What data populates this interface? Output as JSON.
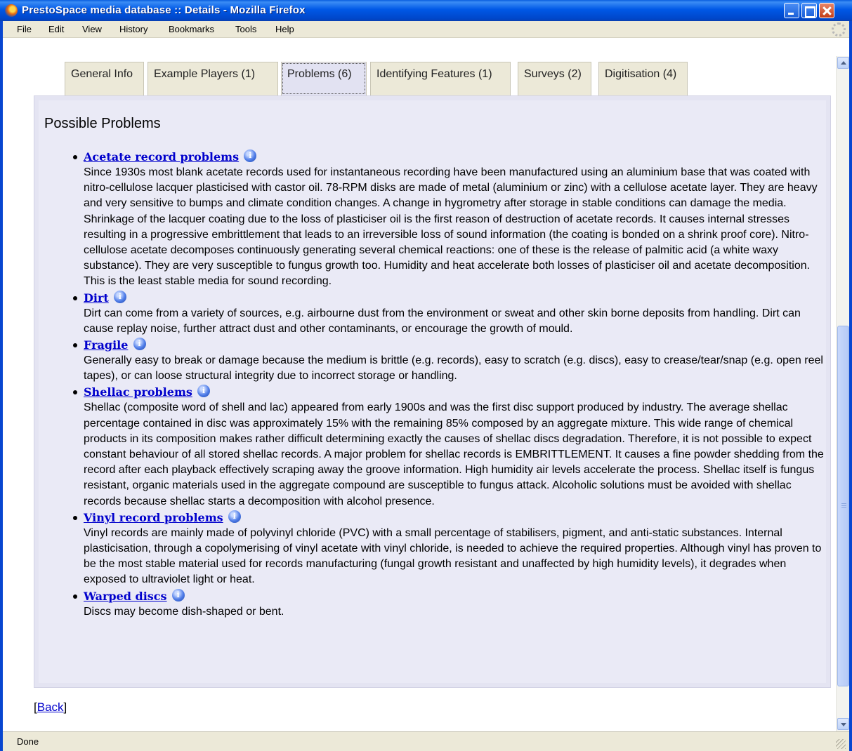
{
  "window": {
    "title": "PrestoSpace media database :: Details - Mozilla Firefox"
  },
  "menu": {
    "items": [
      "File",
      "Edit",
      "View",
      "History",
      "Bookmarks",
      "Tools",
      "Help"
    ]
  },
  "tabs": [
    {
      "label": "General Info",
      "active": false
    },
    {
      "label": "Example Players (1)",
      "active": false
    },
    {
      "label": "Problems (6)",
      "active": true
    },
    {
      "label": "Identifying Features (1)",
      "active": false
    },
    {
      "label": "Surveys (2)",
      "active": false
    },
    {
      "label": "Digitisation (4)",
      "active": false
    }
  ],
  "section_title": "Possible Problems",
  "info_glyph": "i",
  "problems": [
    {
      "title": "Acetate record problems",
      "description": "Since 1930s most blank acetate records used for instantaneous recording have been manufactured using an aluminium base that was coated with nitro-cellulose lacquer plasticised with castor oil. 78-RPM disks are made of metal (aluminium or zinc) with a cellulose acetate layer. They are heavy and very sensitive to bumps and climate condition changes. A change in hygrometry after storage in stable conditions can damage the media. Shrinkage of the lacquer coating due to the loss of plasticiser oil is the first reason of destruction of acetate records. It causes internal stresses resulting in a progressive embrittlement that leads to an irreversible loss of sound information (the coating is bonded on a shrink proof core). Nitro-cellulose acetate decomposes continuously generating several chemical reactions: one of these is the release of palmitic acid (a white waxy substance). They are very susceptible to fungus growth too. Humidity and heat accelerate both losses of plasticiser oil and acetate decomposition. This is the least stable media for sound recording."
    },
    {
      "title": "Dirt",
      "description": "Dirt can come from a variety of sources, e.g. airbourne dust from the environment or sweat and other skin borne deposits from handling. Dirt can cause replay noise, further attract dust and other contaminants, or encourage the growth of mould."
    },
    {
      "title": "Fragile",
      "description": "Generally easy to break or damage because the medium is brittle (e.g. records), easy to scratch (e.g. discs), easy to crease/tear/snap (e.g. open reel tapes), or can loose structural integrity due to incorrect storage or handling."
    },
    {
      "title": "Shellac problems",
      "description": "Shellac (composite word of shell and lac) appeared from early 1900s and was the first disc support produced by industry. The average shellac percentage contained in disc was approximately 15% with the remaining 85% composed by an aggregate mixture. This wide range of chemical products in its composition makes rather difficult determining exactly the causes of shellac discs degradation. Therefore, it is not possible to expect constant behaviour of all stored shellac records. A major problem for shellac records is EMBRITTLEMENT. It causes a fine powder shedding from the record after each playback effectively scraping away the groove information. High humidity air levels accelerate the process. Shellac itself is fungus resistant, organic materials used in the aggregate compound are susceptible to fungus attack. Alcoholic solutions must be avoided with shellac records because shellac starts a decomposition with alcohol presence."
    },
    {
      "title": "Vinyl record problems",
      "description": "Vinyl records are mainly made of polyvinyl chloride (PVC) with a small percentage of stabilisers, pigment, and anti-static substances. Internal plasticisation, through a copolymerising of vinyl acetate with vinyl chloride, is needed to achieve the required properties. Although vinyl has proven to be the most stable material used for records manufacturing (fungal growth resistant and unaffected by high humidity levels), it degrades when exposed to ultraviolet light or heat."
    },
    {
      "title": "Warped discs",
      "description": "Discs may become dish-shaped or bent."
    }
  ],
  "back": {
    "open": "[",
    "label": "Back",
    "close": "]"
  },
  "status": {
    "text": "Done"
  },
  "colors": {
    "titlebar": "#0054e3",
    "panel": "#e4e4f2",
    "link": "#0000cc"
  }
}
